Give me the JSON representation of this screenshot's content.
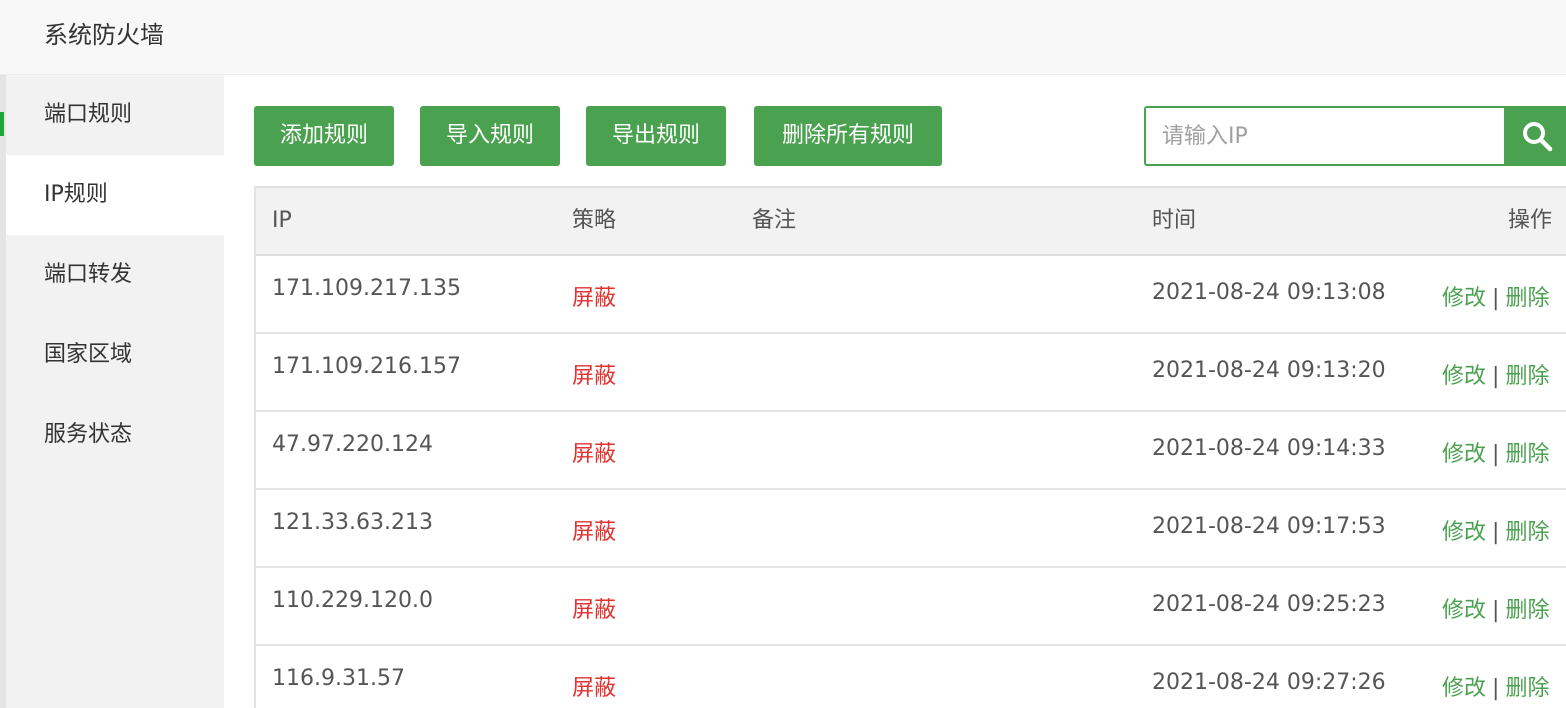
{
  "app": {
    "title": "系统防火墙"
  },
  "sidebar": {
    "items": [
      {
        "label": "端口规则",
        "active": false
      },
      {
        "label": "IP规则",
        "active": true
      },
      {
        "label": "端口转发",
        "active": false
      },
      {
        "label": "国家区域",
        "active": false
      },
      {
        "label": "服务状态",
        "active": false
      }
    ]
  },
  "toolbar": {
    "add_label": "添加规则",
    "import_label": "导入规则",
    "export_label": "导出规则",
    "delete_all_label": "删除所有规则"
  },
  "search": {
    "placeholder": "请输入IP",
    "value": "",
    "icon": "search-icon"
  },
  "table": {
    "columns": {
      "ip": "IP",
      "policy": "策略",
      "remark": "备注",
      "time": "时间",
      "actions": "操作"
    },
    "rows": [
      {
        "ip": "171.109.217.135",
        "policy": "屏蔽",
        "remark": "",
        "time": "2021-08-24 09:13:08",
        "edit": "修改",
        "sep": "|",
        "delete": "删除"
      },
      {
        "ip": "171.109.216.157",
        "policy": "屏蔽",
        "remark": "",
        "time": "2021-08-24 09:13:20",
        "edit": "修改",
        "sep": "|",
        "delete": "删除"
      },
      {
        "ip": "47.97.220.124",
        "policy": "屏蔽",
        "remark": "",
        "time": "2021-08-24 09:14:33",
        "edit": "修改",
        "sep": "|",
        "delete": "删除"
      },
      {
        "ip": "121.33.63.213",
        "policy": "屏蔽",
        "remark": "",
        "time": "2021-08-24 09:17:53",
        "edit": "修改",
        "sep": "|",
        "delete": "删除"
      },
      {
        "ip": "110.229.120.0",
        "policy": "屏蔽",
        "remark": "",
        "time": "2021-08-24 09:25:23",
        "edit": "修改",
        "sep": "|",
        "delete": "删除"
      },
      {
        "ip": "116.9.31.57",
        "policy": "屏蔽",
        "remark": "",
        "time": "2021-08-24 09:27:26",
        "edit": "修改",
        "sep": "|",
        "delete": "删除"
      }
    ]
  },
  "colors": {
    "accent": "#4aa14f",
    "danger": "#e0322f",
    "sidebar_bg": "#f2f2f2"
  }
}
